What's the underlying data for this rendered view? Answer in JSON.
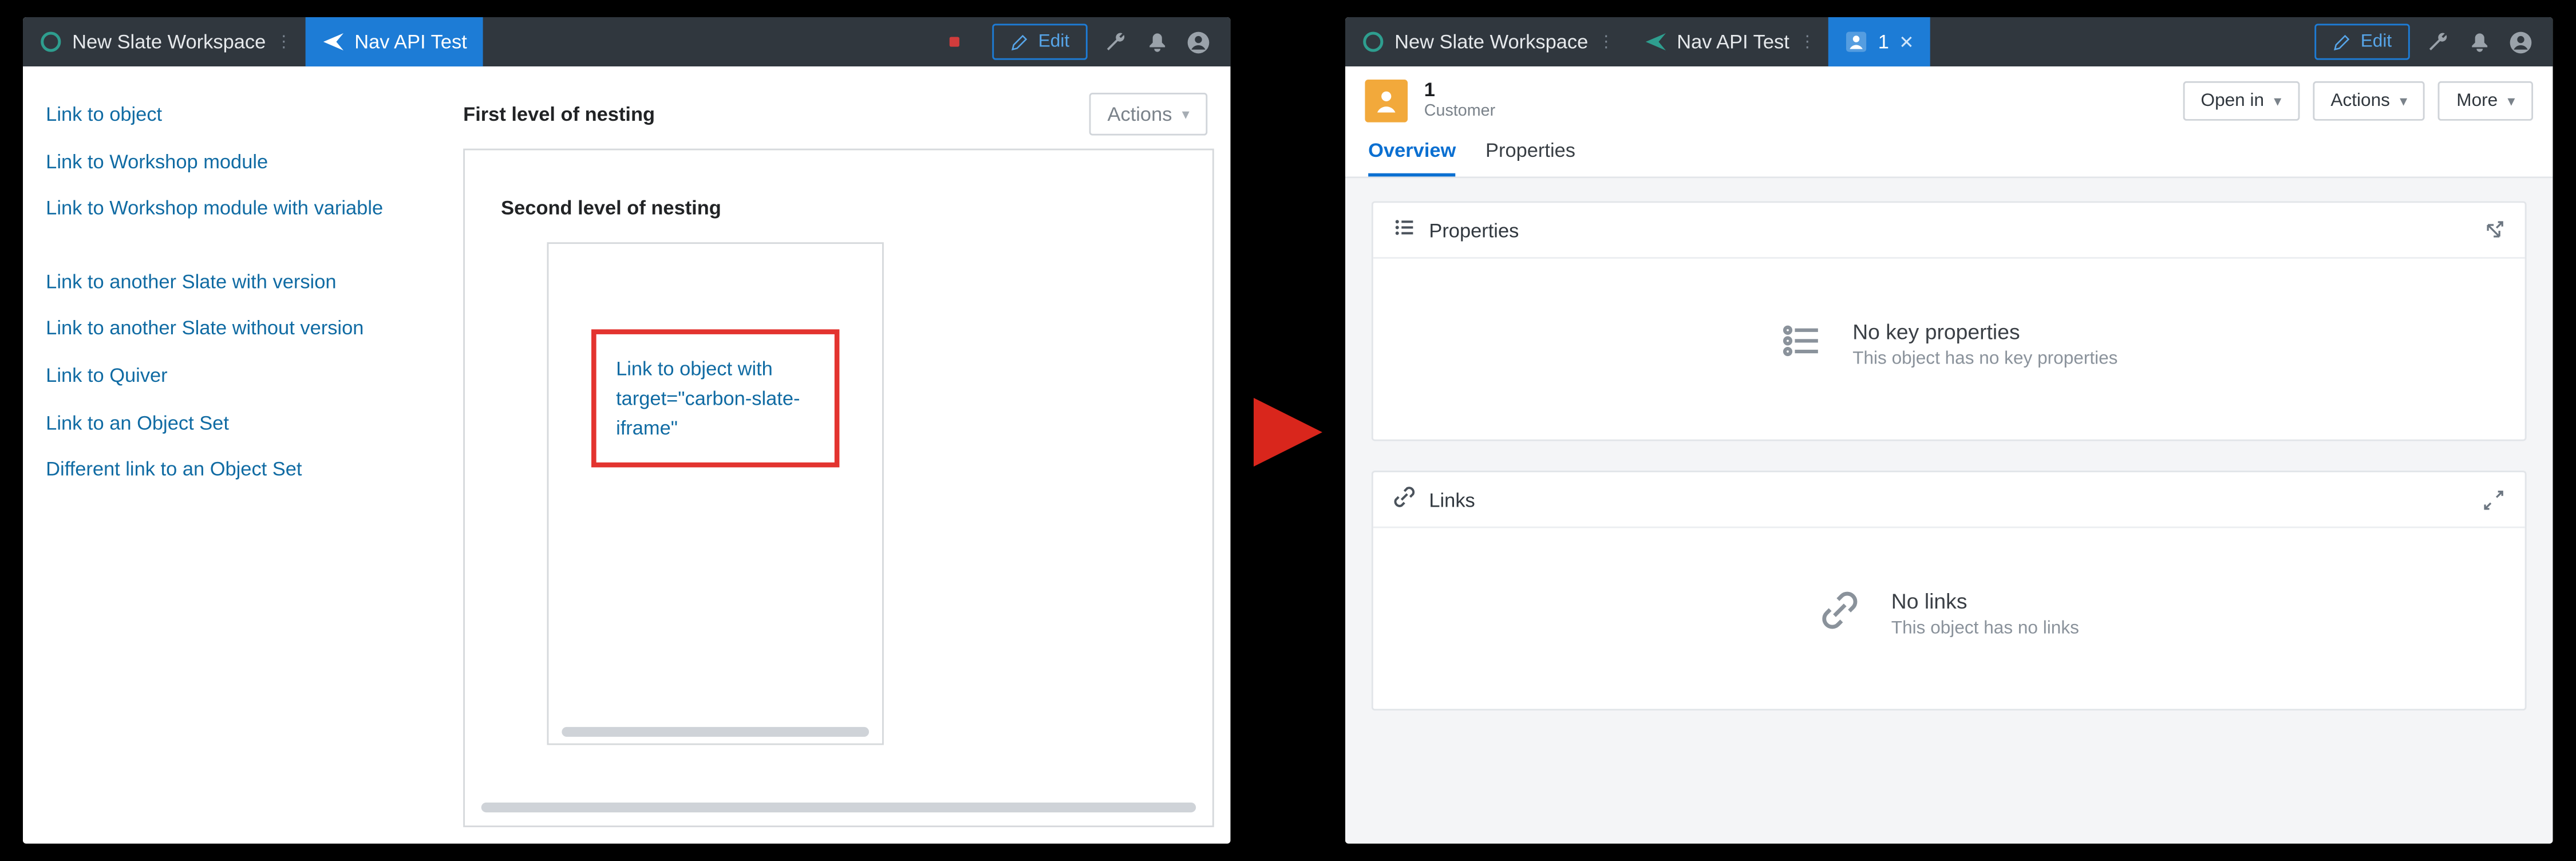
{
  "left": {
    "tabs": {
      "workspace": "New Slate Workspace",
      "nav": "Nav API Test"
    },
    "edit_label": "Edit",
    "sidebar_links": [
      "Link to object",
      "Link to Workshop module",
      "Link to Workshop module with variable",
      "",
      "Link to another Slate with version",
      "Link to another Slate without version",
      "Link to Quiver",
      "Link to an Object Set",
      "Different link to an Object Set"
    ],
    "section1_title": "First level of nesting",
    "actions_label": "Actions",
    "section2_title": "Second level of nesting",
    "callout_link": "Link to object with target=\"carbon-slate-iframe\""
  },
  "right": {
    "tabs": {
      "workspace": "New Slate Workspace",
      "nav": "Nav API Test",
      "object": "1"
    },
    "edit_label": "Edit",
    "object": {
      "title": "1",
      "subtitle": "Customer"
    },
    "header_buttons": {
      "open_in": "Open in",
      "actions": "Actions",
      "more": "More"
    },
    "obj_tabs": {
      "overview": "Overview",
      "properties": "Properties"
    },
    "panel_properties": {
      "title": "Properties",
      "empty_title": "No key properties",
      "empty_sub": "This object has no key properties"
    },
    "panel_links": {
      "title": "Links",
      "empty_title": "No links",
      "empty_sub": "This object has no links"
    }
  }
}
